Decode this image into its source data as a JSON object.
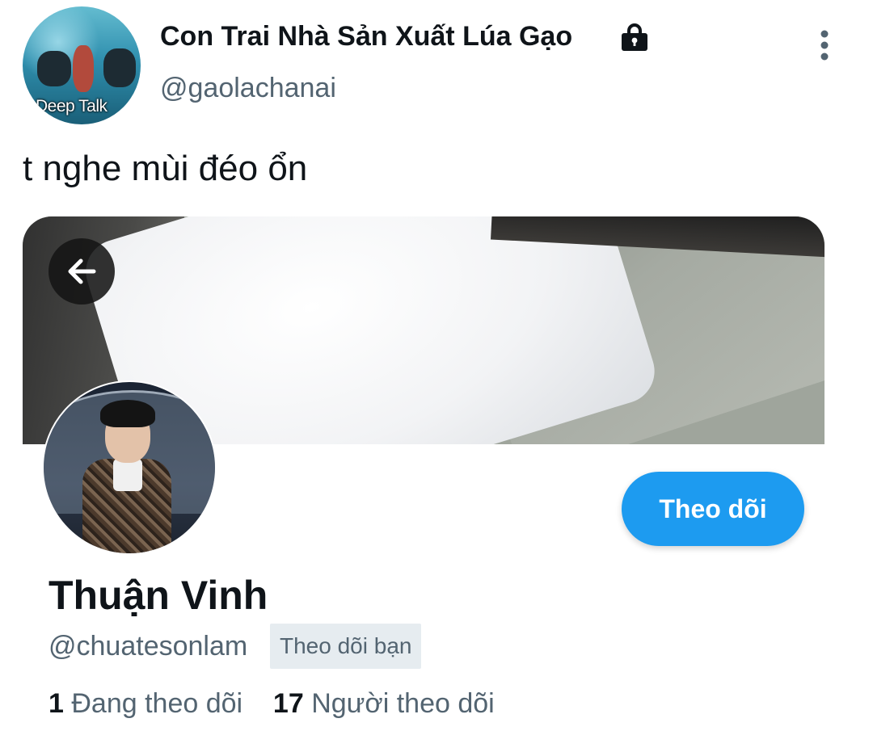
{
  "tweet": {
    "author": {
      "display_name": "Con Trai Nhà Sản Xuất Lúa Gạo",
      "handle": "@gaolachanai",
      "avatar_caption": "Deep Talk",
      "protected_icon": "lock-icon"
    },
    "text": "t nghe mùi đéo ổn",
    "menu_icon": "more-vertical-icon"
  },
  "profile_card": {
    "back_icon": "arrow-left-icon",
    "name": "Thuận Vinh",
    "handle": "@chuatesonlam",
    "follows_you_badge": "Theo dõi bạn",
    "follow_button": "Theo dõi",
    "stats": {
      "following_count": "1",
      "following_label": "Đang theo dõi",
      "followers_count": "17",
      "followers_label": "Người theo dõi"
    }
  },
  "colors": {
    "accent": "#1d9bf0",
    "text_primary": "#0f1419",
    "text_secondary": "#536471",
    "badge_bg": "#e6ecf0"
  }
}
